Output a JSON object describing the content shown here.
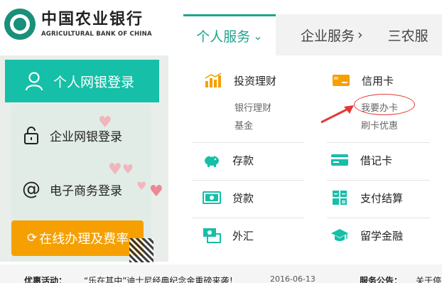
{
  "brand": {
    "name_cn": "中国农业银行",
    "name_en": "AGRICULTURAL BANK OF CHINA"
  },
  "nav": {
    "tabs": [
      {
        "label": "个人服务",
        "arrow": "⌄",
        "active": true
      },
      {
        "label": "企业服务",
        "arrow": "›"
      },
      {
        "label": "三农服"
      }
    ]
  },
  "sidebar": {
    "personal_login": "个人网银登录",
    "corporate_login": "企业网银登录",
    "ecommerce_login": "电子商务登录",
    "online_fees": "在线办理及费率"
  },
  "menu": {
    "investment": {
      "label": "投资理财",
      "links": [
        "银行理财",
        "基金"
      ]
    },
    "credit_card": {
      "label": "信用卡",
      "links": [
        "我要办卡",
        "刷卡优惠"
      ]
    },
    "deposit": {
      "label": "存款"
    },
    "debit_card": {
      "label": "借记卡"
    },
    "loan": {
      "label": "贷款"
    },
    "payment": {
      "label": "支付结算"
    },
    "forex": {
      "label": "外汇"
    },
    "study_abroad": {
      "label": "留学金融"
    }
  },
  "news": {
    "promo_label": "优惠活动：",
    "promo_text": "“乐在其中”迪士尼经典纪念金重磅来袭！",
    "promo_date": "2016-06-13",
    "notice_label": "服务公告：",
    "notice_text": "关于停"
  },
  "colors": {
    "accent": "#16bfa7",
    "orange": "#f5a000",
    "annotation": "#e23a3a"
  }
}
